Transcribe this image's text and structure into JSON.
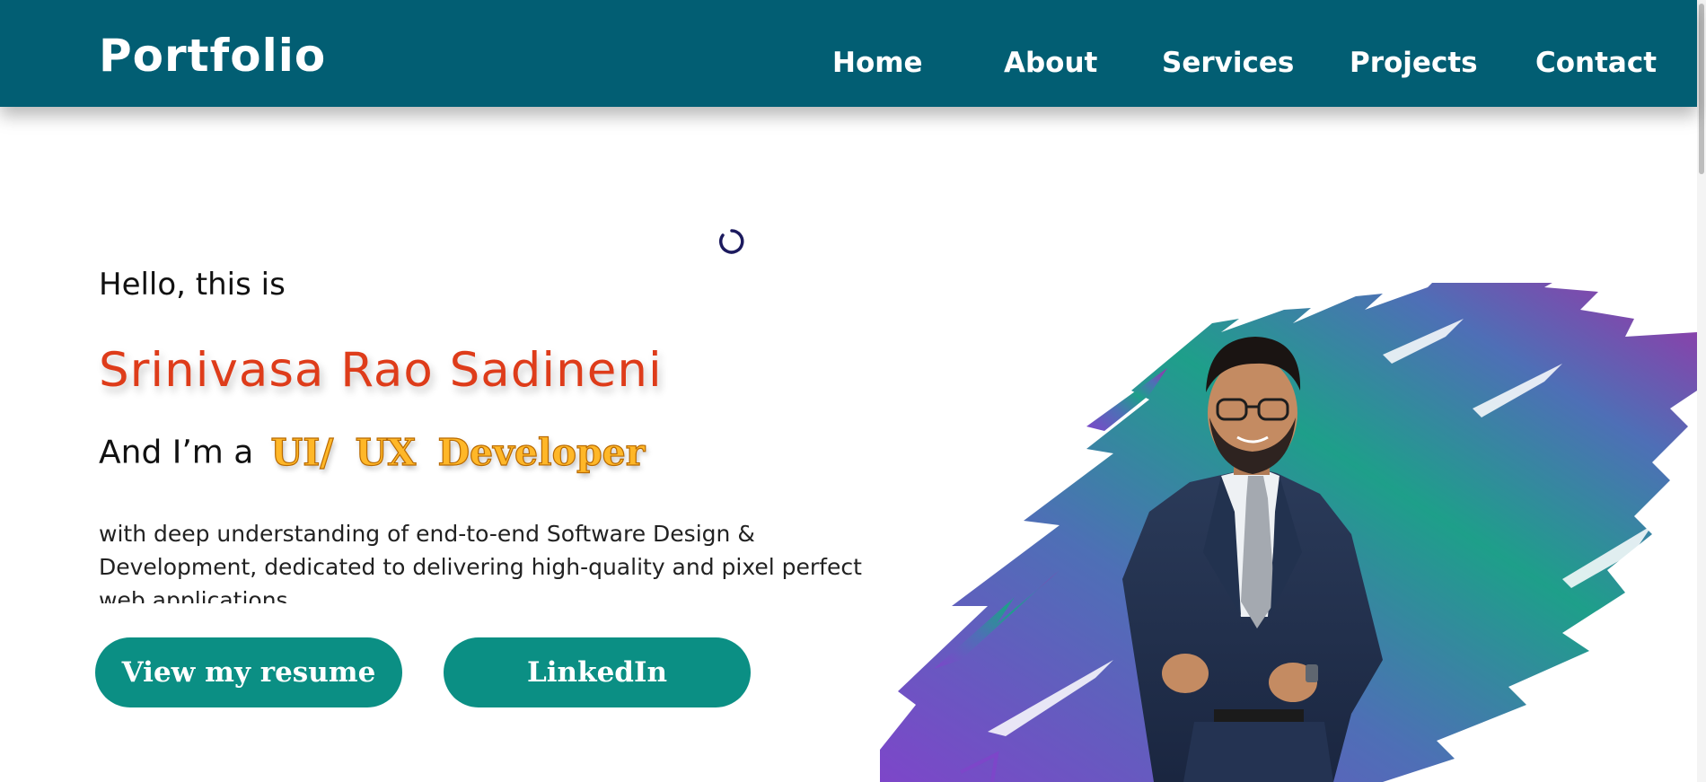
{
  "header": {
    "brand": "Portfolio",
    "nav": [
      "Home",
      "About",
      "Services",
      "Projects",
      "Contact"
    ]
  },
  "hero": {
    "greeting": "Hello, this is",
    "name": "Srinivasa Rao Sadineni",
    "role_prefix": "And I’m a",
    "role_title": "UI/ UX  Developer",
    "description": "with deep understanding of end-to-end Software Design & Development, dedicated to delivering high-quality and pixel perfect web applications."
  },
  "buttons": {
    "resume": "View my resume",
    "linkedin": "LinkedIn"
  },
  "colors": {
    "header_bg": "#025e73",
    "name": "#de3c1a",
    "role_title": "#ffb728",
    "button_bg": "#0b8f84",
    "splash_gradient": [
      "#1e9f8a",
      "#4e6fb6",
      "#7d46c9",
      "#a02fa6"
    ]
  },
  "icons": {
    "spinner": "loading-spinner-icon",
    "portrait": "profile-portrait"
  }
}
